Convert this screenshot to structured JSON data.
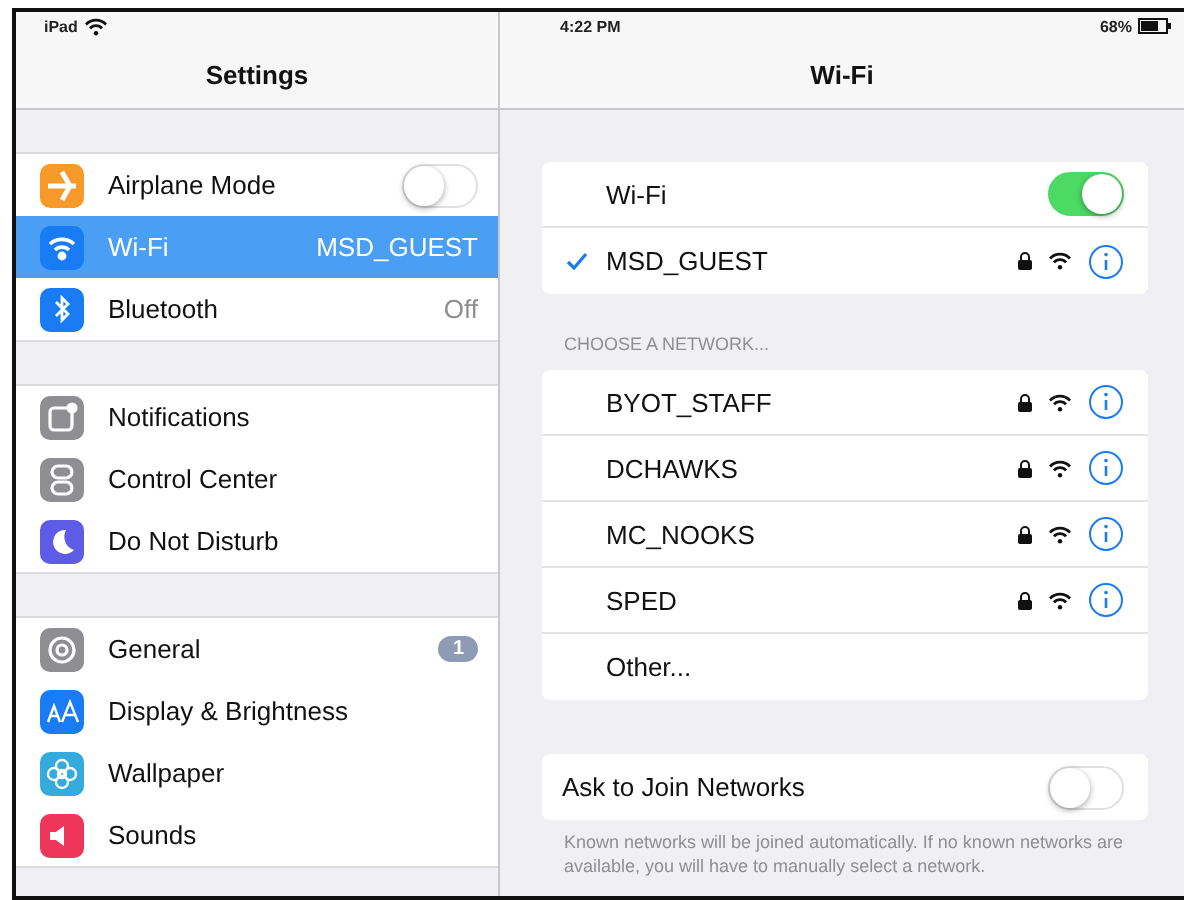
{
  "status_bar": {
    "device": "iPad",
    "time": "4:22 PM",
    "battery": "68%"
  },
  "sidebar": {
    "title": "Settings",
    "groups": [
      [
        {
          "label": "Airplane Mode",
          "kind": "toggle",
          "on": false,
          "selected": false,
          "color": "#f79a2a"
        },
        {
          "label": "Wi-Fi",
          "kind": "value",
          "value": "MSD_GUEST",
          "selected": true,
          "color": "#1a7cf5"
        },
        {
          "label": "Bluetooth",
          "kind": "value",
          "value": "Off",
          "selected": false,
          "color": "#1a7cf5"
        }
      ],
      [
        {
          "label": "Notifications",
          "kind": "plain",
          "selected": false,
          "color": "#8e8e93"
        },
        {
          "label": "Control Center",
          "kind": "plain",
          "selected": false,
          "color": "#8e8e93"
        },
        {
          "label": "Do Not Disturb",
          "kind": "plain",
          "selected": false,
          "color": "#5e5ce6"
        }
      ],
      [
        {
          "label": "General",
          "kind": "badge",
          "badge": "1",
          "selected": false,
          "color": "#8e8e93"
        },
        {
          "label": "Display & Brightness",
          "kind": "plain",
          "selected": false,
          "color": "#1a7cf5"
        },
        {
          "label": "Wallpaper",
          "kind": "plain",
          "selected": false,
          "color": "#35aadc"
        },
        {
          "label": "Sounds",
          "kind": "plain",
          "selected": false,
          "color": "#f0355a"
        }
      ]
    ]
  },
  "detail": {
    "title": "Wi-Fi",
    "wifi": {
      "label": "Wi-Fi",
      "on": true
    },
    "current": {
      "name": "MSD_GUEST",
      "checked": true,
      "locked": true
    },
    "section_header": "CHOOSE A NETWORK...",
    "networks": [
      {
        "name": "BYOT_STAFF",
        "locked": true
      },
      {
        "name": "DCHAWKS",
        "locked": true
      },
      {
        "name": "MC_NOOKS",
        "locked": true
      },
      {
        "name": "SPED",
        "locked": true
      }
    ],
    "other": "Other...",
    "ask": {
      "label": "Ask to Join Networks",
      "on": false
    },
    "footer": "Known networks will be joined automatically. If no known networks are available, you will have to manually select a network."
  }
}
